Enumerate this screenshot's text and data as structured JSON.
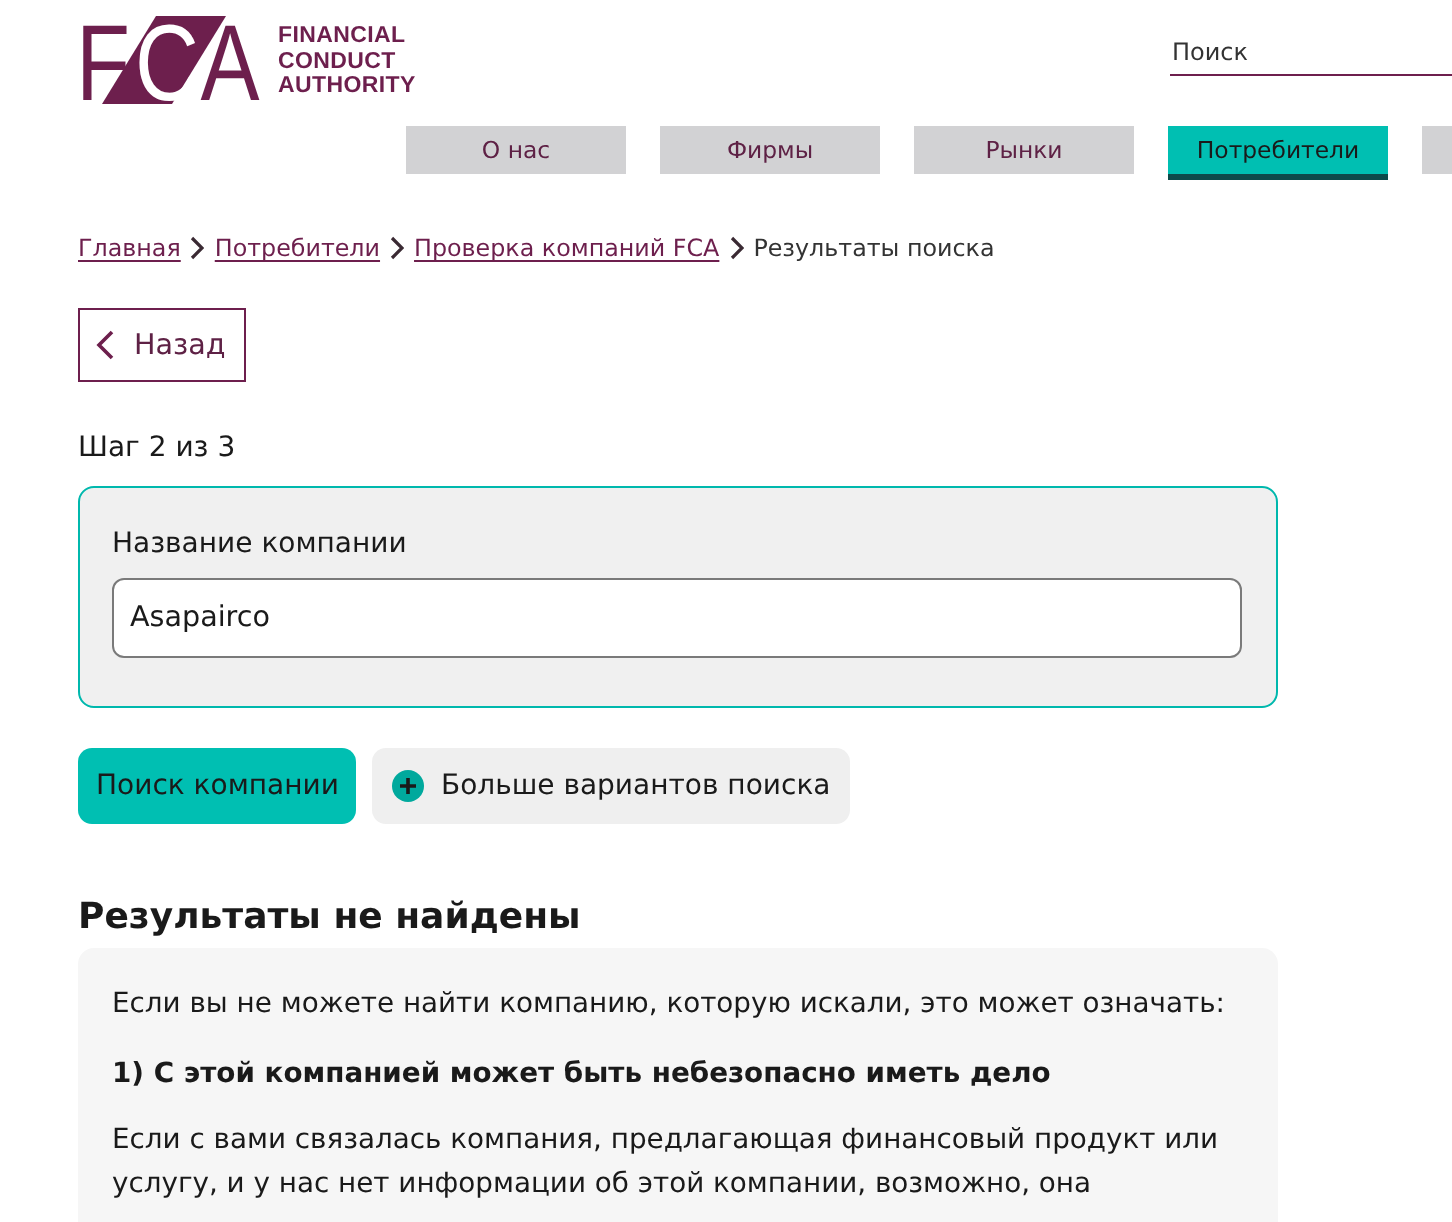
{
  "header": {
    "logo": {
      "letters": [
        "F",
        "C",
        "A"
      ],
      "wordmark": [
        "FINANCIAL",
        "CONDUCT",
        "AUTHORITY"
      ]
    },
    "search": {
      "placeholder": "Поиск"
    }
  },
  "nav": {
    "tabs": [
      {
        "label": "О нас",
        "selected": false
      },
      {
        "label": "Фирмы",
        "selected": false
      },
      {
        "label": "Рынки",
        "selected": false
      },
      {
        "label": "Потребители",
        "selected": true
      },
      {
        "selected": false
      }
    ]
  },
  "breadcrumb": {
    "links": [
      "Главная",
      "Потребители",
      "Проверка компаний FCA"
    ],
    "current": "Результаты поиска"
  },
  "back_button": {
    "label": "Назад"
  },
  "step": "Шаг 2 из 3",
  "search_form": {
    "label": "Название компании",
    "value": "Asapairco"
  },
  "actions": {
    "primary": "Поиск компании",
    "secondary": "Больше вариантов поиска"
  },
  "results": {
    "heading": "Результаты не найдены",
    "intro": "Если вы не можете найти компанию, которую искали, это может означать:",
    "point_heading": "1) С этой компанией может быть небезопасно иметь дело",
    "paragraph": "Если с вами связалась компания, предлагающая финансовый продукт или услугу, и у нас нет информации об этой компании, возможно, она"
  }
}
